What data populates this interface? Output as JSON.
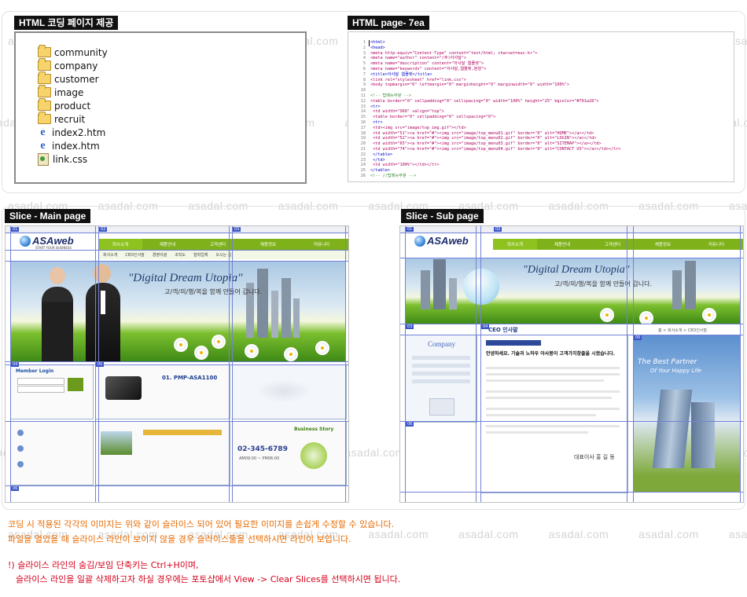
{
  "watermark": "asadal.com",
  "sections": {
    "files_title": "HTML 코딩 페이지 제공",
    "code_title": "HTML page- 7ea",
    "main_title": "Slice - Main page",
    "sub_title": "Slice - Sub page"
  },
  "files": [
    {
      "name": "community",
      "type": "folder"
    },
    {
      "name": "company",
      "type": "folder"
    },
    {
      "name": "customer",
      "type": "folder"
    },
    {
      "name": "image",
      "type": "folder"
    },
    {
      "name": "product",
      "type": "folder"
    },
    {
      "name": "recruit",
      "type": "folder"
    },
    {
      "name": "index2.htm",
      "type": "html"
    },
    {
      "name": "index.htm",
      "type": "html"
    },
    {
      "name": "link.css",
      "type": "css"
    }
  ],
  "code_lines": [
    {
      "n": "1",
      "t": "<html>"
    },
    {
      "n": "2",
      "t": "<head>"
    },
    {
      "n": "3",
      "t": "<meta http-equiv=\"Content-Type\" content=\"text/html; charset=euc-kr\">"
    },
    {
      "n": "4",
      "t": "<meta name=\"author\" content=\"(주)아사달\">"
    },
    {
      "n": "5",
      "t": "<meta name=\"description\" content=\"아사달 웹플렛\">"
    },
    {
      "n": "6",
      "t": "<meta name=\"keywords\" content=\"아사달,웹플렛,분양\">"
    },
    {
      "n": "7",
      "t": "<title>아사달 웹플렛</title>"
    },
    {
      "n": "8",
      "t": "<link rel=\"stylesheet\" href=\"link.css\">"
    },
    {
      "n": "9",
      "t": "<body topmargin=\"0\" leftmargin=\"0\" marginheight=\"0\" marginwidth=\"0\" width=\"100%\">"
    },
    {
      "n": "10",
      "t": ""
    },
    {
      "n": "11",
      "t": "<!-- 탑메뉴부분 -->"
    },
    {
      "n": "12",
      "t": "<table border=\"0\" cellpadding=\"0\" cellspacing=\"0\" width=\"100%\" height=\"25\" bgcolor=\"#791a28\">"
    },
    {
      "n": "13",
      "t": "<tr>"
    },
    {
      "n": "14",
      "t": "  <td width=\"960\" valign=\"top\">"
    },
    {
      "n": "15",
      "t": "    <table border=\"0\" cellpadding=\"0\" cellspacing=\"0\">"
    },
    {
      "n": "16",
      "t": "    <tr>"
    },
    {
      "n": "17",
      "t": "      <td><img src=\"image/top_img.gif\"></td>"
    },
    {
      "n": "18",
      "t": "      <td width=\"51\"><a href=\"#\"><img src=\"image/top_menu01.gif\" border=\"0\" alt=\"HOME\"></a></td>"
    },
    {
      "n": "19",
      "t": "      <td width=\"52\"><a href=\"#\"><img src=\"image/top_menu02.gif\" border=\"0\" alt=\"LOGIN\"></a></td>"
    },
    {
      "n": "20",
      "t": "      <td width=\"65\"><a href=\"#\"><img src=\"image/top_menu03.gif\" border=\"0\" alt=\"SITEMAP\"></a></td>"
    },
    {
      "n": "21",
      "t": "      <td width=\"74\"><a href=\"#\"><img src=\"image/top_menu04.gif\" border=\"0\" alt=\"CONTACT US\"></a></td></tr>"
    },
    {
      "n": "22",
      "t": "    </table>"
    },
    {
      "n": "23",
      "t": "  </td>"
    },
    {
      "n": "24",
      "t": "  <td width=\"100%\"></td></tr>"
    },
    {
      "n": "25",
      "t": "</table>"
    },
    {
      "n": "26",
      "t": "<!-- //탑메뉴부분 -->"
    }
  ],
  "main_mock": {
    "logo": "ASAweb",
    "logo_sub": "START YOUR BUSINESS",
    "nav": [
      "회사소개",
      "제품안내",
      "고객센터",
      "채용정보",
      "커뮤니티"
    ],
    "subnav": [
      "회사소개",
      "CEO인사말",
      "경영이념",
      "조직도",
      "협력업체",
      "오시는 길"
    ],
    "banner_title": "\"Digital Dream Utopia\"",
    "banner_sub": "고/객/의/행/복을 함께 만들어 갑니다.",
    "login_label": "Member Login",
    "product_label": "01. PMP-ASA1100",
    "phone": "02-345-6789",
    "phone_hours": "AM09:00 ~ PM06:00",
    "story_label": "Business Story"
  },
  "sub_mock": {
    "logo": "ASAweb",
    "banner_title": "\"Digital Dream Utopia\"",
    "banner_sub": "고/객/의/행/복을 함께 만들어 갑니다.",
    "page_heading": "CEO 인사말",
    "company_label": "Company",
    "greeting_title": "안녕하세요. 기술과 노하우 아사봉이 고객가치창출을 시켰습니다.",
    "partner_line1": "The Best Partner",
    "partner_line2": "Of Your Happy Life",
    "signature": "대표이사 홍 길 동",
    "breadcrumb": "홈 > 회사소개 > CEO인사말"
  },
  "notes": {
    "line1": "코딩 시 적용된 각각의 이미지는 위와 같이 슬라이스 되어 있어 필요한 이미지를 손쉽게 수정할 수 있습니다.",
    "line2": "파일을 열었을 때 슬라이스 라인이 보이지 않을 경우 슬라이스툴을 선택하시면 라인이 보입니다.",
    "line3": "!) 슬라이스 라인의 숨김/보임 단축키는 Ctrl+H이며,",
    "line4": "슬라이스 라인을 일괄 삭제하고자 하실 경우에는 포토샵에서 View -> Clear Slices를 선택하시면 됩니다."
  },
  "colors": {
    "accent_green": "#8dc21f",
    "slice_blue": "#3a55c8",
    "note_orange": "#e86a00",
    "note_red": "#d4001a"
  }
}
